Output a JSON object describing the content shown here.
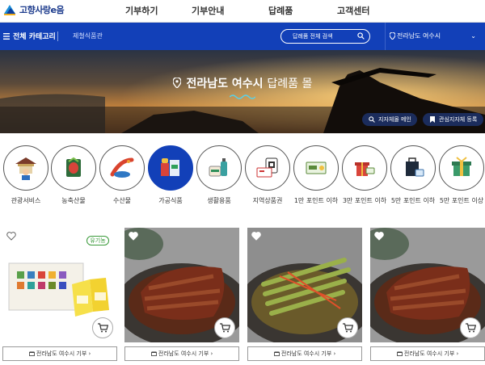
{
  "brand": {
    "name": "고향사랑e음"
  },
  "topnav": [
    "기부하기",
    "기부안내",
    "답례품",
    "고객센터"
  ],
  "bluebar": {
    "category_label": "전체 카테고리",
    "sub_link": "제철식품관",
    "search_placeholder": "답례품 전체 검색",
    "region": "전라남도 여수시"
  },
  "hero": {
    "title_bold": "전라남도 여수시",
    "title_light": "답례품 몰",
    "btn_change": "지자체몰 메인",
    "btn_fav": "관심지자체 등록"
  },
  "categories": [
    {
      "label": "관광서비스",
      "icon": "tourism-icon"
    },
    {
      "label": "농축산물",
      "icon": "agriculture-icon"
    },
    {
      "label": "수산물",
      "icon": "seafood-icon"
    },
    {
      "label": "가공식품",
      "icon": "processed-food-icon"
    },
    {
      "label": "생활용품",
      "icon": "household-icon"
    },
    {
      "label": "지역상품권",
      "icon": "voucher-icon"
    },
    {
      "label": "1만 포인트 이하",
      "icon": "point-10k-icon"
    },
    {
      "label": "3만 포인트 이하",
      "icon": "point-30k-icon"
    },
    {
      "label": "5만 포인트 이하",
      "icon": "point-50k-icon"
    },
    {
      "label": "5만 포인트 이상",
      "icon": "point-50k-plus-icon"
    }
  ],
  "products": [
    {
      "footer": "전라남도 여수시 기부",
      "badge": "유기농"
    },
    {
      "footer": "전라남도 여수시 기부"
    },
    {
      "footer": "전라남도 여수시 기부"
    },
    {
      "footer": "전라남도 여수시 기부"
    }
  ],
  "colors": {
    "primary": "#1240b8",
    "nav_dark": "#1b2c5c"
  }
}
